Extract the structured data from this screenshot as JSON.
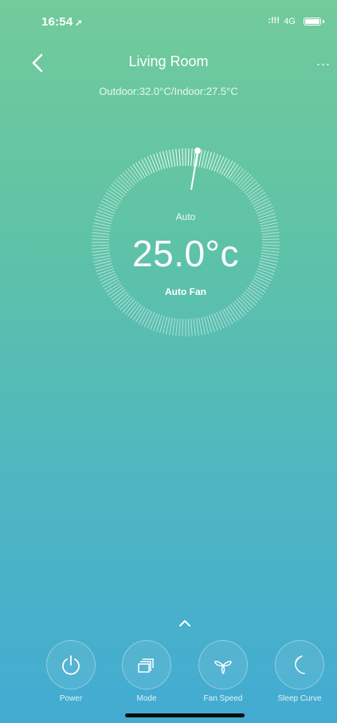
{
  "status": {
    "time": "16:54",
    "signal": ":!!!",
    "network": "4G"
  },
  "header": {
    "title": "Living Room",
    "more": "..."
  },
  "temps": "Outdoor:32.0°C/Indoor:27.5°C",
  "dial": {
    "mode": "Auto",
    "temperature": "25.0°c",
    "fan": "Auto Fan"
  },
  "controls": [
    {
      "label": "Power",
      "icon": "power-icon"
    },
    {
      "label": "Mode",
      "icon": "mode-icon"
    },
    {
      "label": "Fan Speed",
      "icon": "fan-icon"
    },
    {
      "label": "Sleep Curve",
      "icon": "moon-icon"
    }
  ]
}
